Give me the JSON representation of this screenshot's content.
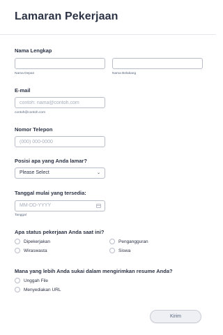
{
  "form": {
    "title": "Lamaran Pekerjaan",
    "full_name": {
      "label": "Nama Lengkap",
      "first_sublabel": "Nama Depan",
      "last_sublabel": "Nama Belakang",
      "first_value": "",
      "last_value": ""
    },
    "email": {
      "label": "E-mail",
      "placeholder": "contoh: nama@contoh.com",
      "sublabel": "contoh@contoh.com"
    },
    "phone": {
      "label": "Nomor Telepon",
      "placeholder": "(000) 000-0000"
    },
    "position": {
      "label": "Posisi apa yang Anda lamar?",
      "selected": "Please Select"
    },
    "start_date": {
      "label": "Tanggal mulai yang tersedia:",
      "placeholder": "MM-DD-YYYY",
      "sublabel": "Tanggal"
    },
    "employment_status": {
      "label": "Apa status pekerjaan Anda saat ini?",
      "options": [
        "Dipekerjakan",
        "Pengangguran",
        "Wiraswasta",
        "Siswa"
      ]
    },
    "resume": {
      "label": "Mana yang lebih Anda sukai dalam mengirimkan resume Anda?",
      "options": [
        "Unggah File",
        "Menyediakan URL"
      ]
    },
    "submit_label": "Kirim"
  }
}
